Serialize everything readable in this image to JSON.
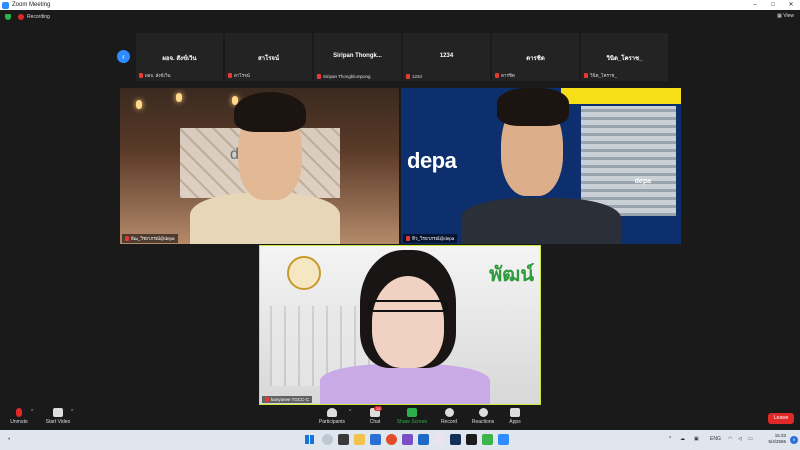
{
  "window": {
    "title": "Zoom Meeting",
    "controls": [
      "–",
      "□",
      "✕"
    ]
  },
  "recording": {
    "label": "Recording",
    "view_label": "View"
  },
  "thumbnails": [
    {
      "name": "ผอจ. สังข์เวิน",
      "sub": "ผอจ. สังข์เวิน"
    },
    {
      "name": "สาโรจน์",
      "sub": "สาโรจน์"
    },
    {
      "name": "Siripan  Thongk...",
      "sub": "Siripan Thongklumpong"
    },
    {
      "name": "1234",
      "sub": "1234"
    },
    {
      "name": "ดารชิต",
      "sub": "ดารชิต"
    },
    {
      "name": "วินิต_โคราช_",
      "sub": "วินิต_โคราช_"
    }
  ],
  "tiles": [
    {
      "label": "ธีฒ_วิรยาภรณ์@depa"
    },
    {
      "label": "ทิว_วิรยาภรณ์@depa"
    },
    {
      "label": "kanyanee TGCC-C"
    }
  ],
  "tile_texts": {
    "depa_logo": "depa",
    "depa_small": "depa",
    "wall_text": "de",
    "thai_banner": "พัฒน์"
  },
  "toolbar": {
    "unmute": "Unmute",
    "start_video": "Start Video",
    "participants": "Participants",
    "participants_count": "44",
    "chat": "Chat",
    "chat_badge": "28",
    "share_screen": "Share Screen",
    "record": "Record",
    "reactions": "Reactions",
    "apps": "Apps",
    "leave": "Leave"
  },
  "taskbar": {
    "lang": "ENG",
    "time": "15:33",
    "date": "5/4/2565",
    "notif_count": "9"
  },
  "colors": {
    "accent": "#2d8cff",
    "danger": "#e02828",
    "share": "#2bb24c",
    "speaker_border": "#c7e83a"
  }
}
